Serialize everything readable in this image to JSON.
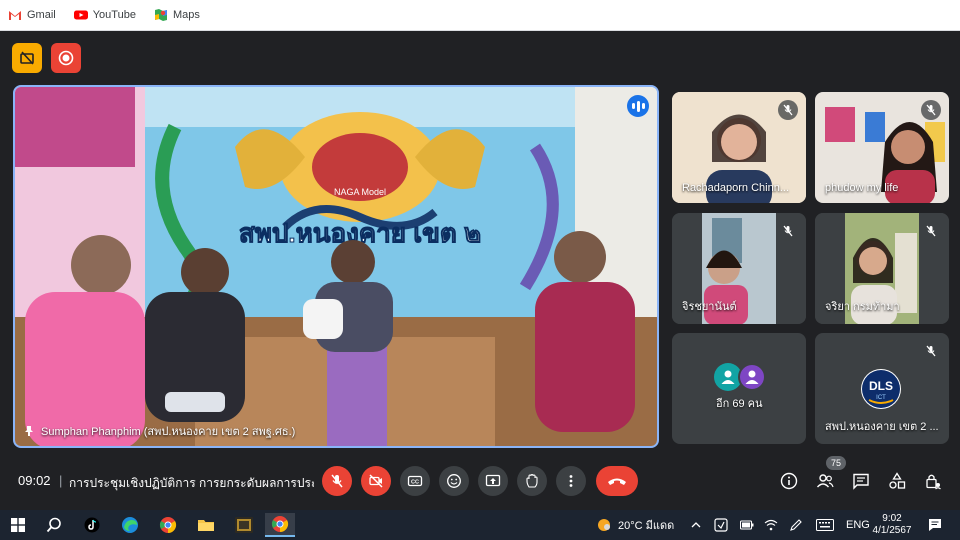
{
  "bookmarks": [
    {
      "label": "Gmail",
      "icon": "gmail-icon"
    },
    {
      "label": "YouTube",
      "icon": "youtube-icon"
    },
    {
      "label": "Maps",
      "icon": "maps-icon"
    }
  ],
  "main_video": {
    "participant": "Sumphan Phanphim (สพป.หนองคาย เขต 2 สพฐ.ศธ.)",
    "banner_text": "สพป.หนองคาย เขต ๒",
    "banner_small": "NAGA Model"
  },
  "tiles": [
    {
      "name": "Rachadaporn Chinn...",
      "muted": true
    },
    {
      "name": "phudow my life",
      "muted": true
    },
    {
      "name": "จิรชยานันต์",
      "muted": true
    },
    {
      "name": "จริยา กรมท้ามา",
      "muted": true
    },
    {
      "name": "อีก 69 คน",
      "muted": false
    },
    {
      "name": "สพป.หนองคาย เขต 2 ...",
      "muted": true,
      "logo_text": "DLS",
      "logo_sub": "ICT"
    }
  ],
  "meeting": {
    "time": "09:02",
    "separator": "|",
    "title": "การประชุมเชิงปฏิบัติการ การยกระดับผลการประเ...",
    "participant_count": "75"
  },
  "taskbar": {
    "weather": "20°C มีแดด",
    "lang": "ENG",
    "time": "9:02",
    "date": "4/1/2567"
  },
  "colors": {
    "meet_bg": "#202124",
    "accent_red": "#ea4335",
    "accent_yellow": "#f9ab00",
    "active_border": "#8ab4f8"
  }
}
